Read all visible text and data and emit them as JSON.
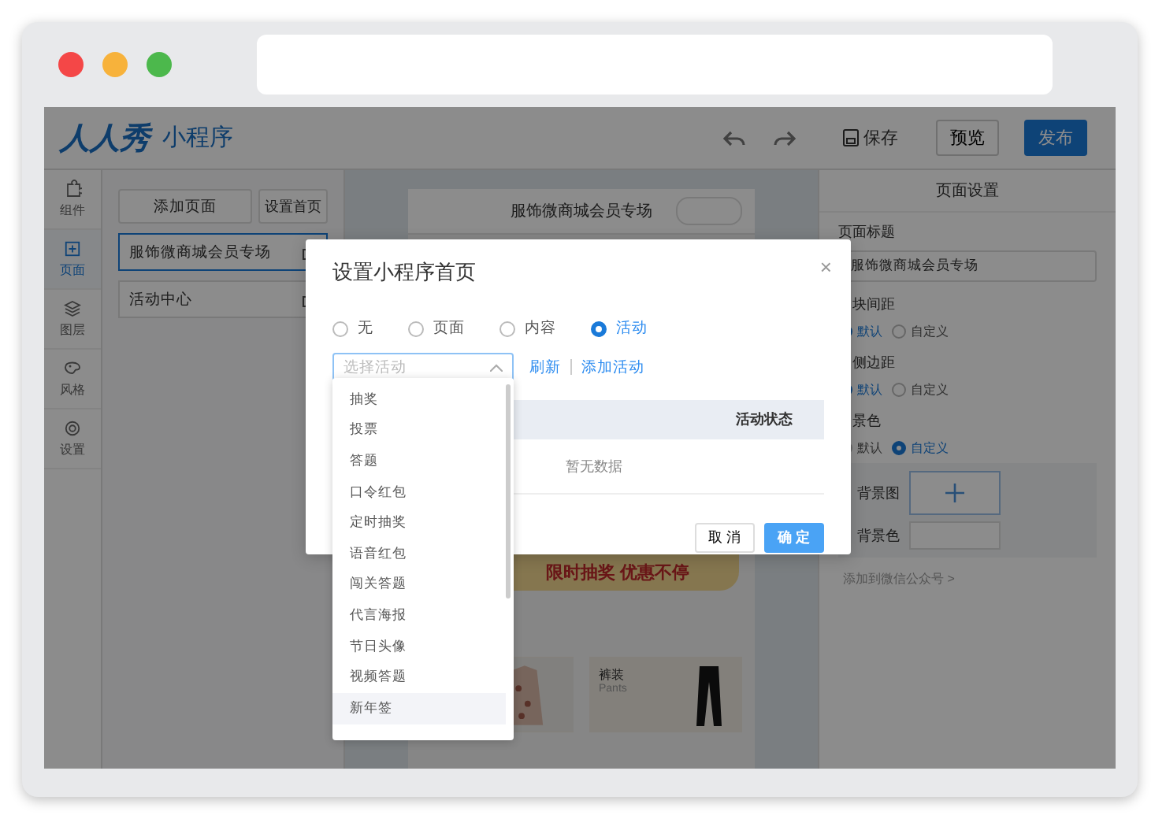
{
  "app": {
    "logo": "人人秀",
    "product": "小程序",
    "save": "保存",
    "preview": "预览",
    "publish": "发布"
  },
  "rail": [
    {
      "label": "组件",
      "selected": false
    },
    {
      "label": "页面",
      "selected": true
    },
    {
      "label": "图层",
      "selected": false
    },
    {
      "label": "风格",
      "selected": false
    },
    {
      "label": "设置",
      "selected": false
    }
  ],
  "pages_panel": {
    "add_page": "添加页面",
    "set_home": "设置首页",
    "pages": [
      {
        "name": "服饰微商城会员专场",
        "selected": true
      },
      {
        "name": "活动中心",
        "selected": false
      }
    ]
  },
  "preview": {
    "title": "服饰微商城会员专场",
    "banner": "限时抽奖 优惠不停",
    "cards": [
      {
        "title": "裤装",
        "subtitle": "Pants"
      }
    ]
  },
  "settings": {
    "title": "页面设置",
    "title_label": "页面标题",
    "title_value": "服饰微商城会员专场",
    "groups": [
      {
        "label": "块间距",
        "options": [
          {
            "label": "默认",
            "selected": true
          },
          {
            "label": "自定义",
            "selected": false
          }
        ]
      },
      {
        "label": "侧边距",
        "options": [
          {
            "label": "默认",
            "selected": true
          },
          {
            "label": "自定义",
            "selected": false
          }
        ]
      },
      {
        "label": "景色",
        "options": [
          {
            "label": "默认",
            "selected": false
          },
          {
            "label": "自定义",
            "selected": true
          }
        ]
      }
    ],
    "bg_image_label": "背景图",
    "bg_color_label": "背景色",
    "wechat_link": "添加到微信公众号 >"
  },
  "modal": {
    "title": "设置小程序首页",
    "close": "×",
    "types": [
      {
        "label": "无",
        "selected": false
      },
      {
        "label": "页面",
        "selected": false
      },
      {
        "label": "内容",
        "selected": false
      },
      {
        "label": "活动",
        "selected": true
      }
    ],
    "select": {
      "placeholder": "选择活动",
      "expanded": true
    },
    "refresh": "刷新",
    "add_activity": "添加活动",
    "table": {
      "columns": [
        "活动状态"
      ],
      "empty": "暂无数据"
    },
    "cancel": "取 消",
    "ok": "确 定"
  },
  "dropdown": [
    {
      "label": "抽奖",
      "hovered": false
    },
    {
      "label": "投票",
      "hovered": false
    },
    {
      "label": "答题",
      "hovered": false
    },
    {
      "label": "口令红包",
      "hovered": false
    },
    {
      "label": "定时抽奖",
      "hovered": false
    },
    {
      "label": "语音红包",
      "hovered": false
    },
    {
      "label": "闯关答题",
      "hovered": false
    },
    {
      "label": "代言海报",
      "hovered": false
    },
    {
      "label": "节日头像",
      "hovered": false
    },
    {
      "label": "视频答题",
      "hovered": false
    },
    {
      "label": "新年签",
      "hovered": true
    }
  ]
}
